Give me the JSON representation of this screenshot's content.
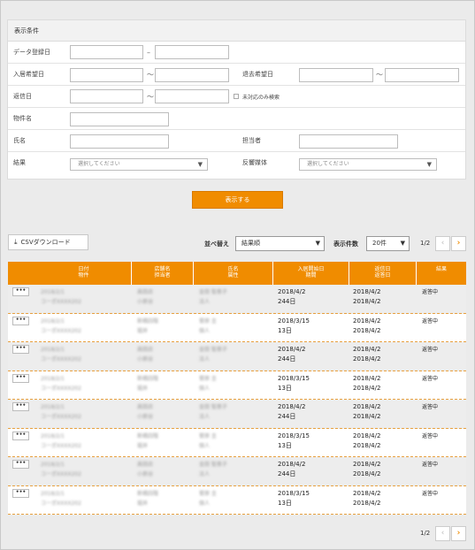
{
  "conditions": {
    "title": "表示条件",
    "labels": {
      "data_date": "データ登録日",
      "move_in": "入居希望日",
      "move_out": "退去希望日",
      "reply_date": "返信日",
      "property": "物件名",
      "name": "氏名",
      "staff": "担当者",
      "result": "結果",
      "media": "反響媒体"
    },
    "range_sep": "〜",
    "dash_sep": "–",
    "unresolved_label": "未対応のみ検索",
    "select_placeholder": "選択してください"
  },
  "show_button": "表示する",
  "csv_button": "CSVダウンロード",
  "sort": {
    "label": "並べ替え",
    "value": "結果順"
  },
  "count": {
    "label": "表示件数",
    "value": "20件"
  },
  "pager": {
    "text": "1/2",
    "prev": "‹",
    "next": "›"
  },
  "table": {
    "headers": [
      [
        "日付",
        "物件"
      ],
      [
        "店舗名",
        "担当者"
      ],
      [
        "氏名",
        "属性"
      ],
      [
        "入居開始日",
        "期間"
      ],
      [
        "返信日",
        "返答日"
      ],
      [
        "結果"
      ]
    ],
    "more_label": "•••",
    "rows": [
      {
        "b1": "2018/2/1",
        "b2": "コーポXXXX202",
        "s1": "高田店",
        "s2": "小原谷",
        "n1": "金田 智恵子",
        "n2": "法人",
        "d1": "2018/4/2",
        "d2": "244日",
        "r1": "2018/4/2",
        "r2": "2018/4/2",
        "res": "返答中"
      },
      {
        "b1": "2018/2/1",
        "b2": "コーポXXXX202",
        "s1": "新橋四階",
        "s2": "堀井",
        "n1": "菅原 圭",
        "n2": "個人",
        "d1": "2018/3/15",
        "d2": "13日",
        "r1": "2018/4/2",
        "r2": "2018/4/2",
        "res": "返答中"
      },
      {
        "b1": "2018/2/1",
        "b2": "コーポXXXX202",
        "s1": "高田店",
        "s2": "小原谷",
        "n1": "金田 智恵子",
        "n2": "法人",
        "d1": "2018/4/2",
        "d2": "244日",
        "r1": "2018/4/2",
        "r2": "2018/4/2",
        "res": "返答中"
      },
      {
        "b1": "2018/2/1",
        "b2": "コーポXXXX202",
        "s1": "新橋四階",
        "s2": "堀井",
        "n1": "菅原 圭",
        "n2": "個人",
        "d1": "2018/3/15",
        "d2": "13日",
        "r1": "2018/4/2",
        "r2": "2018/4/2",
        "res": "返答中"
      },
      {
        "b1": "2018/2/1",
        "b2": "コーポXXXX202",
        "s1": "高田店",
        "s2": "小原谷",
        "n1": "金田 智恵子",
        "n2": "法人",
        "d1": "2018/4/2",
        "d2": "244日",
        "r1": "2018/4/2",
        "r2": "2018/4/2",
        "res": "返答中"
      },
      {
        "b1": "2018/2/1",
        "b2": "コーポXXXX202",
        "s1": "新橋四階",
        "s2": "堀井",
        "n1": "菅原 圭",
        "n2": "個人",
        "d1": "2018/3/15",
        "d2": "13日",
        "r1": "2018/4/2",
        "r2": "2018/4/2",
        "res": "返答中"
      },
      {
        "b1": "2018/2/1",
        "b2": "コーポXXXX202",
        "s1": "高田店",
        "s2": "小原谷",
        "n1": "金田 智恵子",
        "n2": "法人",
        "d1": "2018/4/2",
        "d2": "244日",
        "r1": "2018/4/2",
        "r2": "2018/4/2",
        "res": "返答中"
      },
      {
        "b1": "2018/2/1",
        "b2": "コーポXXXX202",
        "s1": "新橋四階",
        "s2": "堀井",
        "n1": "菅原 圭",
        "n2": "個人",
        "d1": "2018/3/15",
        "d2": "13日",
        "r1": "2018/4/2",
        "r2": "2018/4/2",
        "res": "返答中"
      }
    ]
  }
}
